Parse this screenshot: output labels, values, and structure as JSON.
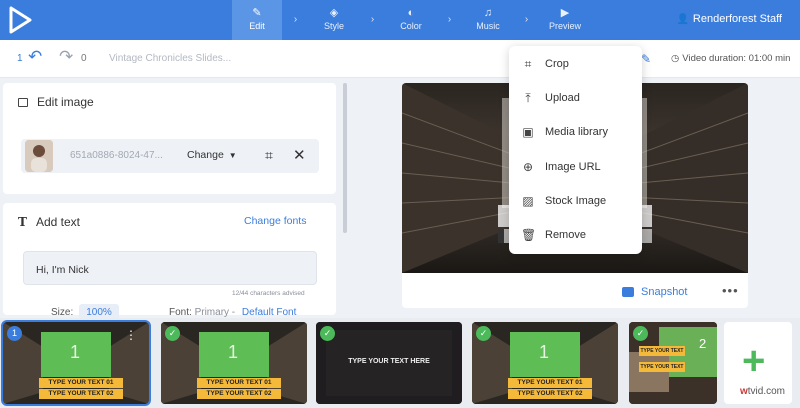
{
  "topbar": {
    "steps": [
      {
        "label": "Edit",
        "icon": "pencil-icon",
        "active": true
      },
      {
        "label": "Style",
        "icon": "layers-icon",
        "active": false
      },
      {
        "label": "Color",
        "icon": "palette-icon",
        "active": false
      },
      {
        "label": "Music",
        "icon": "music-icon",
        "active": false
      },
      {
        "label": "Preview",
        "icon": "play-icon",
        "active": false
      }
    ],
    "user_name": "Renderforest Staff"
  },
  "toolbar": {
    "undo_count": "1",
    "redo_count": "0",
    "project_title": "Vintage Chronicles Slides...",
    "video_duration": "Video duration: 01:00 min"
  },
  "edit_image": {
    "title": "Edit image",
    "file_name": "651a0886-8024-47...",
    "change_label": "Change"
  },
  "add_text": {
    "title": "Add text",
    "change_fonts": "Change fonts",
    "text_value": "Hi, I'm Nick",
    "char_count": "12/44 characters advised",
    "size_label": "Size:",
    "size_value": "100%",
    "font_label": "Font:",
    "font_primary": "Primary -",
    "font_default": "Default Font"
  },
  "preview": {
    "snapshot_label": "Snapshot"
  },
  "image_menu": {
    "items": [
      {
        "label": "Crop",
        "icon": "crop-icon"
      },
      {
        "label": "Upload",
        "icon": "upload-icon"
      },
      {
        "label": "Media library",
        "icon": "media-library-icon"
      },
      {
        "label": "Image URL",
        "icon": "globe-icon"
      },
      {
        "label": "Stock Image",
        "icon": "stock-image-icon"
      },
      {
        "label": "Remove",
        "icon": "trash-icon"
      }
    ]
  },
  "scenes": [
    {
      "badge": "1",
      "badge_type": "number",
      "big_number": "1",
      "banner1": "TYPE YOUR TEXT 01",
      "banner2": "TYPE YOUR TEXT 02"
    },
    {
      "badge": "✓",
      "badge_type": "check",
      "big_number": "1",
      "banner1": "TYPE YOUR TEXT 01",
      "banner2": "TYPE YOUR TEXT 02"
    },
    {
      "badge": "✓",
      "badge_type": "check",
      "text": "TYPE YOUR TEXT HERE"
    },
    {
      "badge": "✓",
      "badge_type": "check",
      "big_number": "1",
      "banner1": "TYPE YOUR TEXT 01",
      "banner2": "TYPE YOUR TEXT 02"
    },
    {
      "badge": "✓",
      "badge_type": "check",
      "big_number": "2",
      "banner1": "TYPE YOUR TEXT",
      "banner2": "TYPE YOUR TEXT"
    }
  ],
  "watermark": {
    "brand": "w",
    "rest": "tvid.com"
  },
  "colors": {
    "accent": "#3b7ddd",
    "success": "#4cba5a",
    "banner_yellow": "#f5b93a"
  }
}
